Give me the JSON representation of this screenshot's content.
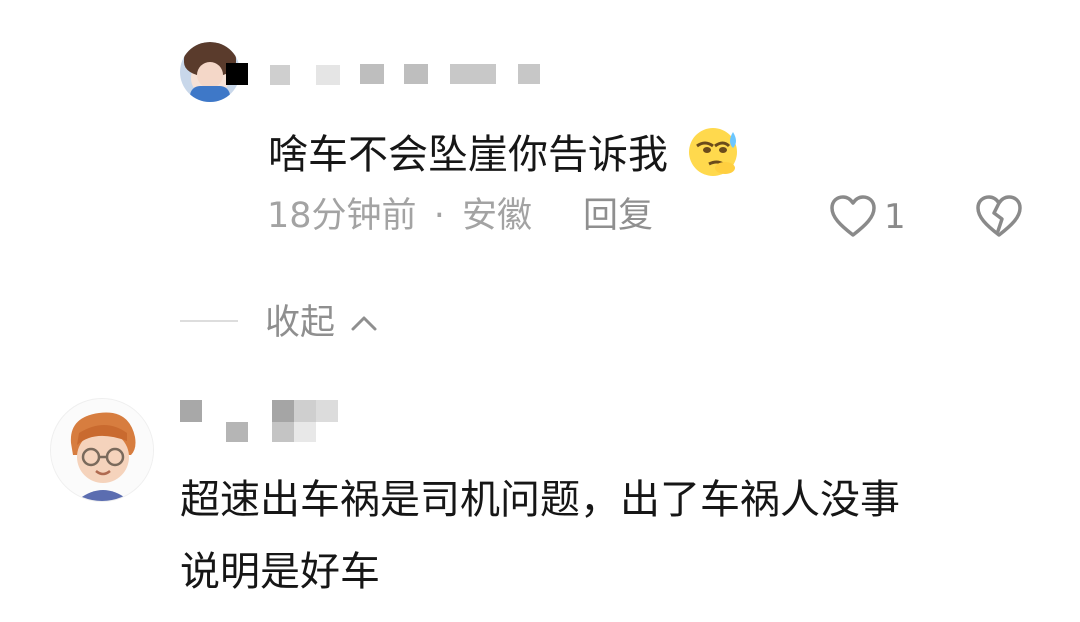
{
  "comment_reply": {
    "text": "啥车不会坠崖你告诉我",
    "emoji": "sly-sweat-emoji",
    "time": "18分钟前",
    "separator": "·",
    "location": "安徽",
    "reply_label": "回复",
    "like_count": "1"
  },
  "collapse_label": "收起",
  "comment_main": {
    "text_line1": "超速出车祸是司机问题，出了车祸人没事",
    "text_line2": "说明是好车"
  },
  "icons": {
    "heart": "heart-icon",
    "broken_heart": "broken-heart-icon",
    "chevron": "chevron-up-icon"
  },
  "colors": {
    "primary_text": "#161616",
    "secondary_text": "#a3a3a3",
    "icon_gray": "#8a8a8a"
  }
}
